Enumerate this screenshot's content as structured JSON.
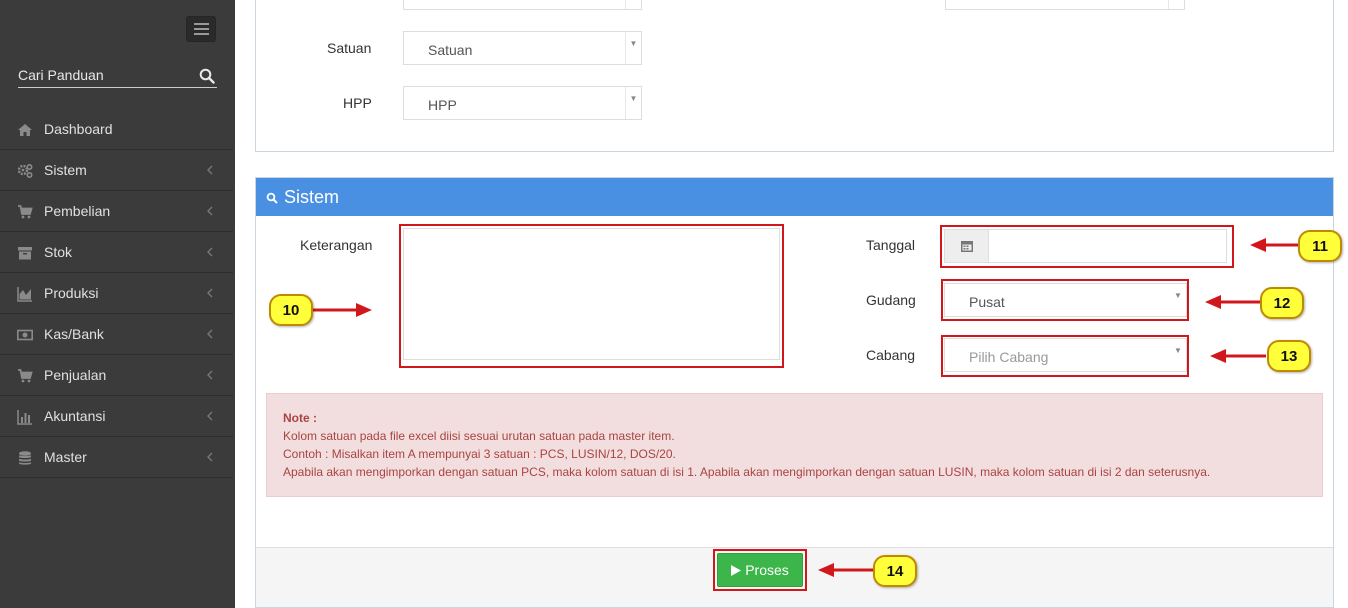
{
  "sidebar": {
    "search_placeholder": "Cari Panduan",
    "items": [
      {
        "label": "Dashboard"
      },
      {
        "label": "Sistem"
      },
      {
        "label": "Pembelian"
      },
      {
        "label": "Stok"
      },
      {
        "label": "Produksi"
      },
      {
        "label": "Kas/Bank"
      },
      {
        "label": "Penjualan"
      },
      {
        "label": "Akuntansi"
      },
      {
        "label": "Master"
      }
    ]
  },
  "top_form": {
    "satuan_label": "Satuan",
    "satuan_value": "Satuan",
    "hpp_label": "HPP",
    "hpp_value": "HPP"
  },
  "sistem": {
    "title": "Sistem",
    "keterangan_label": "Keterangan",
    "tanggal_label": "Tanggal",
    "gudang_label": "Gudang",
    "gudang_value": "Pusat",
    "cabang_label": "Cabang",
    "cabang_placeholder": "Pilih Cabang"
  },
  "note": {
    "title": "Note :",
    "line1": "Kolom satuan pada file excel diisi sesuai urutan satuan pada master item.",
    "line2": "Contoh : Misalkan item A mempunyai 3 satuan : PCS, LUSIN/12, DOS/20.",
    "line3": "Apabila akan mengimporkan dengan satuan PCS, maka kolom satuan di isi 1. Apabila akan mengimporkan dengan satuan LUSIN, maka kolom satuan di isi 2 dan seterusnya."
  },
  "proses_label": "Proses",
  "callouts": [
    "10",
    "11",
    "12",
    "13",
    "14"
  ],
  "colors": {
    "sidebar_bg": "#3b3b3b",
    "panel_header": "#4a90e2",
    "button_green": "#3cb54a",
    "annotation_red": "#d0181c",
    "callout_yellow": "#ffff3a"
  }
}
